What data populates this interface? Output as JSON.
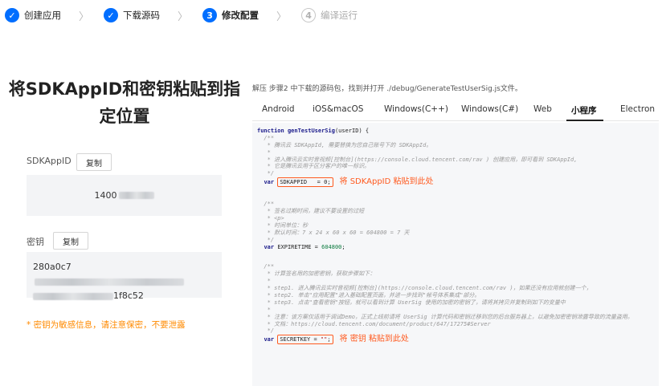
{
  "steps": [
    {
      "number": "1",
      "label": "创建应用",
      "state": "done"
    },
    {
      "number": "2",
      "label": "下载源码",
      "state": "done"
    },
    {
      "number": "3",
      "label": "修改配置",
      "state": "active"
    },
    {
      "number": "4",
      "label": "编译运行",
      "state": "todo"
    }
  ],
  "left": {
    "title": "将SDKAppID和密钥粘贴到指定位置",
    "sdkappid_label": "SDKAppID",
    "sdkappid_copy": "复制",
    "sdkappid_value_prefix": "1400",
    "secret_label": "密钥",
    "secret_copy": "复制",
    "secret_value_prefix": "280a0c7",
    "secret_value_suffix": "1f8c52",
    "warning": "* 密钥为敏感信息，请注意保密，不要泄露"
  },
  "right": {
    "intro": "解压 步骤2 中下载的源码包，找到并打开 ./debug/GenerateTestUserSig.js文件。",
    "tabs": [
      "Android",
      "iOS&macOS",
      "Windows(C++)",
      "Windows(C#)",
      "Web",
      "小程序",
      "Electron"
    ],
    "active_tab": "小程序",
    "code": {
      "l1_kw": "function",
      "l1_fn": "genTestUserSig",
      "l1_rest": "(userID) {",
      "c1": "  /**",
      "c2": "   * 腾讯云 SDKAppId, 需要替换为您自己账号下的 SDKAppId。",
      "c3": "   *",
      "c4": "   * 进入腾讯云实时音视频[控制台](https://console.cloud.tencent.com/rav ) 创建应用，即可看到 SDKAppId,",
      "c5": "   * 它是腾讯云用于区分客户的唯一标识。",
      "c6": "   */",
      "v1_kw": "var",
      "v1_code": "SDKAPPID   = 0;",
      "v1_anno": "将 SDKAppID 粘贴到此处",
      "d1": "  /**",
      "d2": "   * 签名过期时间，建议不要设置的过短",
      "d3": "   * <p>",
      "d4": "   * 时间单位：秒",
      "d5": "   * 默认时间：7 x 24 x 60 x 60 = 604800 = 7 天",
      "d6": "   */",
      "v2_kw": "var",
      "v2_code": "EXPIRETIME = ",
      "v2_num": "604800",
      "v2_end": ";",
      "e1": "  /**",
      "e2": "   * 计算签名用的加密密钥，获取步骤如下：",
      "e3": "   *",
      "e4": "   * step1. 进入腾讯云实时音视频[控制台](https://console.cloud.tencent.com/rav )，如果还没有应用就创建一个，",
      "e5": "   * step2. 单击\"应用配置\"进入基础配置页面，并进一步找到\"帐号体系集成\"部分。",
      "e6": "   * step3. 点击\"查看密钥\"按钮，就可以看到计算 UserSig 使用的加密的密钥了，请将其拷贝并复制到如下的变量中",
      "e7": "   *",
      "e8": "   * 注意：该方案仅适用于调试Demo，正式上线前请将 UserSig 计算代码和密钥迁移到您的后台服务器上，以避免加密密钥泄露导致的流量盗用。",
      "e9": "   * 文档：https://cloud.tencent.com/document/product/647/17275#Server",
      "e10": "   */",
      "v3_kw": "var",
      "v3_code": "SECRETKEY = ",
      "v3_str": "\"\"",
      "v3_end": ";",
      "v3_anno": "将 密钥 粘贴到此处"
    }
  },
  "colors": {
    "accent": "#006eff",
    "highlight": "#ff5a1f",
    "warning": "#ff8a00"
  }
}
